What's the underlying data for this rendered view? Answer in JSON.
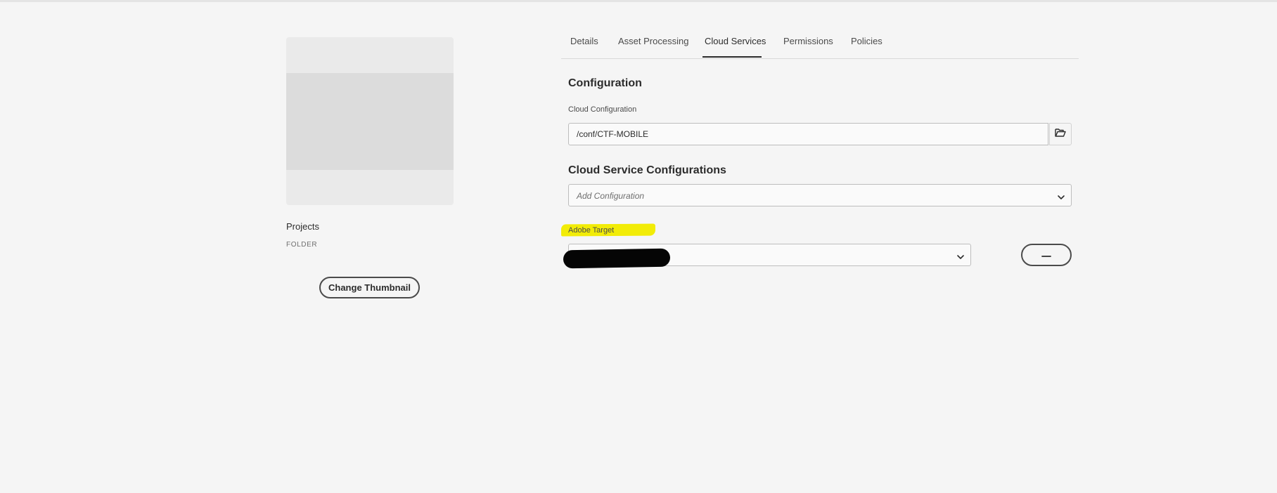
{
  "asset": {
    "name": "Projects",
    "type": "FOLDER",
    "change_thumbnail_label": "Change Thumbnail"
  },
  "tabs": [
    {
      "label": "Details",
      "selected": false
    },
    {
      "label": "Asset Processing",
      "selected": false
    },
    {
      "label": "Cloud Services",
      "selected": true
    },
    {
      "label": "Permissions",
      "selected": false
    },
    {
      "label": "Policies",
      "selected": false
    }
  ],
  "configuration": {
    "heading": "Configuration",
    "cloud_configuration_label": "Cloud Configuration",
    "cloud_configuration_value": "/conf/CTF-MOBILE",
    "browse_icon": "folder-open-icon"
  },
  "cloud_service_configurations": {
    "heading": "Cloud Service Configurations",
    "add_placeholder": "Add Configuration",
    "adobe_target_label": "Adobe Target",
    "adobe_target_value": "",
    "remove_icon": "minus-icon"
  },
  "colors": {
    "highlight": "#f2ec07",
    "redaction": "#050505",
    "background": "#f5f5f5"
  }
}
